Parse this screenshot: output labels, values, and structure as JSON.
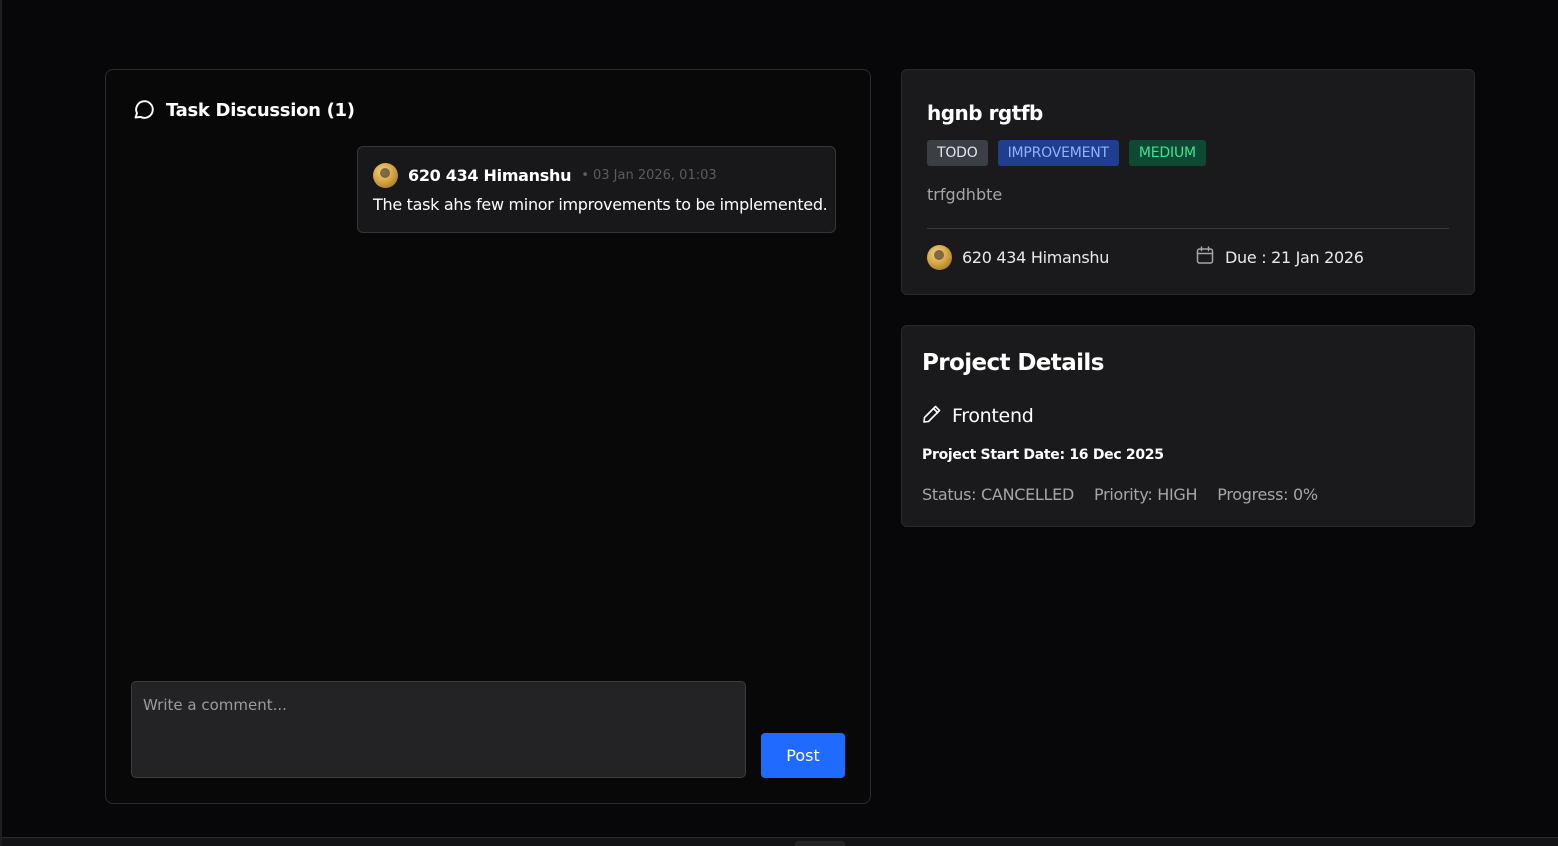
{
  "discussion": {
    "title": "Task Discussion (1)",
    "comments": [
      {
        "author": "620 434 Himanshu",
        "timestamp": "• 03 Jan 2026, 01:03",
        "text": "The task ahs few minor improvements to be implemented."
      }
    ],
    "input": {
      "value": "",
      "placeholder": "Write a comment..."
    },
    "post_label": "Post"
  },
  "task": {
    "title": "hgnb rgtfb",
    "badges": {
      "status": "TODO",
      "type": "IMPROVEMENT",
      "priority": "MEDIUM"
    },
    "description": "trfgdhbte",
    "assignee": "620 434 Himanshu",
    "due": "Due : 21 Jan 2026"
  },
  "project": {
    "heading": "Project Details",
    "name": "Frontend",
    "start_date": "Project Start Date: 16 Dec 2025",
    "status": "Status: CANCELLED",
    "priority": "Priority: HIGH",
    "progress": "Progress: 0%"
  },
  "colors": {
    "background": "#070709",
    "card": "#1a1a1d",
    "accent": "#1f6bff",
    "badge_improvement": "#1f3e8f",
    "badge_medium": "#0e4a33"
  },
  "icons": {
    "discussion": "chat-bubble-icon",
    "due": "calendar-icon",
    "project": "pencil-icon"
  }
}
